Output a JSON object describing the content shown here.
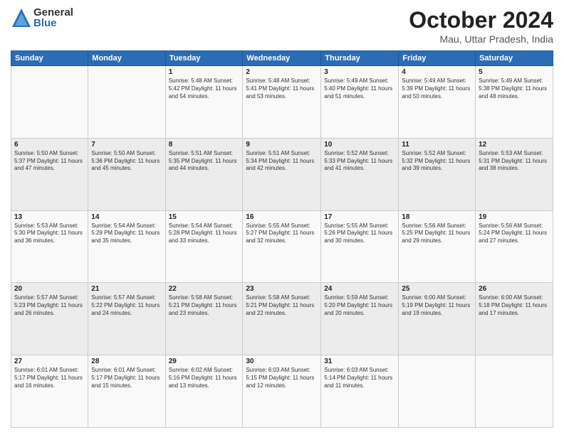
{
  "logo": {
    "general": "General",
    "blue": "Blue"
  },
  "title": "October 2024",
  "location": "Mau, Uttar Pradesh, India",
  "days_header": [
    "Sunday",
    "Monday",
    "Tuesday",
    "Wednesday",
    "Thursday",
    "Friday",
    "Saturday"
  ],
  "weeks": [
    [
      {
        "day": "",
        "info": ""
      },
      {
        "day": "",
        "info": ""
      },
      {
        "day": "1",
        "info": "Sunrise: 5:48 AM\nSunset: 5:42 PM\nDaylight: 11 hours\nand 54 minutes."
      },
      {
        "day": "2",
        "info": "Sunrise: 5:48 AM\nSunset: 5:41 PM\nDaylight: 11 hours\nand 53 minutes."
      },
      {
        "day": "3",
        "info": "Sunrise: 5:49 AM\nSunset: 5:40 PM\nDaylight: 11 hours\nand 51 minutes."
      },
      {
        "day": "4",
        "info": "Sunrise: 5:49 AM\nSunset: 5:39 PM\nDaylight: 11 hours\nand 50 minutes."
      },
      {
        "day": "5",
        "info": "Sunrise: 5:49 AM\nSunset: 5:38 PM\nDaylight: 11 hours\nand 48 minutes."
      }
    ],
    [
      {
        "day": "6",
        "info": "Sunrise: 5:50 AM\nSunset: 5:37 PM\nDaylight: 11 hours\nand 47 minutes."
      },
      {
        "day": "7",
        "info": "Sunrise: 5:50 AM\nSunset: 5:36 PM\nDaylight: 11 hours\nand 45 minutes."
      },
      {
        "day": "8",
        "info": "Sunrise: 5:51 AM\nSunset: 5:35 PM\nDaylight: 11 hours\nand 44 minutes."
      },
      {
        "day": "9",
        "info": "Sunrise: 5:51 AM\nSunset: 5:34 PM\nDaylight: 11 hours\nand 42 minutes."
      },
      {
        "day": "10",
        "info": "Sunrise: 5:52 AM\nSunset: 5:33 PM\nDaylight: 11 hours\nand 41 minutes."
      },
      {
        "day": "11",
        "info": "Sunrise: 5:52 AM\nSunset: 5:32 PM\nDaylight: 11 hours\nand 39 minutes."
      },
      {
        "day": "12",
        "info": "Sunrise: 5:53 AM\nSunset: 5:31 PM\nDaylight: 11 hours\nand 38 minutes."
      }
    ],
    [
      {
        "day": "13",
        "info": "Sunrise: 5:53 AM\nSunset: 5:30 PM\nDaylight: 11 hours\nand 36 minutes."
      },
      {
        "day": "14",
        "info": "Sunrise: 5:54 AM\nSunset: 5:29 PM\nDaylight: 11 hours\nand 35 minutes."
      },
      {
        "day": "15",
        "info": "Sunrise: 5:54 AM\nSunset: 5:28 PM\nDaylight: 11 hours\nand 33 minutes."
      },
      {
        "day": "16",
        "info": "Sunrise: 5:55 AM\nSunset: 5:27 PM\nDaylight: 11 hours\nand 32 minutes."
      },
      {
        "day": "17",
        "info": "Sunrise: 5:55 AM\nSunset: 5:26 PM\nDaylight: 11 hours\nand 30 minutes."
      },
      {
        "day": "18",
        "info": "Sunrise: 5:56 AM\nSunset: 5:25 PM\nDaylight: 11 hours\nand 29 minutes."
      },
      {
        "day": "19",
        "info": "Sunrise: 5:56 AM\nSunset: 5:24 PM\nDaylight: 11 hours\nand 27 minutes."
      }
    ],
    [
      {
        "day": "20",
        "info": "Sunrise: 5:57 AM\nSunset: 5:23 PM\nDaylight: 11 hours\nand 26 minutes."
      },
      {
        "day": "21",
        "info": "Sunrise: 5:57 AM\nSunset: 5:22 PM\nDaylight: 11 hours\nand 24 minutes."
      },
      {
        "day": "22",
        "info": "Sunrise: 5:58 AM\nSunset: 5:21 PM\nDaylight: 11 hours\nand 23 minutes."
      },
      {
        "day": "23",
        "info": "Sunrise: 5:58 AM\nSunset: 5:21 PM\nDaylight: 11 hours\nand 22 minutes."
      },
      {
        "day": "24",
        "info": "Sunrise: 5:59 AM\nSunset: 5:20 PM\nDaylight: 11 hours\nand 20 minutes."
      },
      {
        "day": "25",
        "info": "Sunrise: 6:00 AM\nSunset: 5:19 PM\nDaylight: 11 hours\nand 19 minutes."
      },
      {
        "day": "26",
        "info": "Sunrise: 6:00 AM\nSunset: 5:18 PM\nDaylight: 11 hours\nand 17 minutes."
      }
    ],
    [
      {
        "day": "27",
        "info": "Sunrise: 6:01 AM\nSunset: 5:17 PM\nDaylight: 11 hours\nand 16 minutes."
      },
      {
        "day": "28",
        "info": "Sunrise: 6:01 AM\nSunset: 5:17 PM\nDaylight: 11 hours\nand 15 minutes."
      },
      {
        "day": "29",
        "info": "Sunrise: 6:02 AM\nSunset: 5:16 PM\nDaylight: 11 hours\nand 13 minutes."
      },
      {
        "day": "30",
        "info": "Sunrise: 6:03 AM\nSunset: 5:15 PM\nDaylight: 11 hours\nand 12 minutes."
      },
      {
        "day": "31",
        "info": "Sunrise: 6:03 AM\nSunset: 5:14 PM\nDaylight: 11 hours\nand 11 minutes."
      },
      {
        "day": "",
        "info": ""
      },
      {
        "day": "",
        "info": ""
      }
    ]
  ]
}
